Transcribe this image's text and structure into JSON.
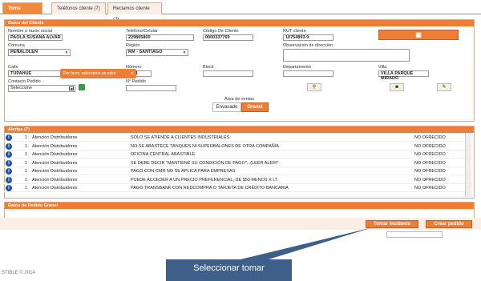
{
  "tabs": [
    "Toma Pedido",
    "Teléfonos cliente (7)",
    "Reclamos cliente (7)"
  ],
  "client": {
    "header": "Datos del Cliente",
    "name_label": "Nombre o razón social",
    "name_value": "PAOLA SUSANA ALVAR",
    "phone_label": "Teléfono/Celular",
    "phone_value": "229805800",
    "code_label": "Código De Cliente",
    "code_value": "0000337769",
    "rut_label": "RUT cliente",
    "rut_value": "10754893-9",
    "comuna_label": "Comuna",
    "comuna_value": "PEÑALOLEN",
    "region_label": "Región",
    "region_value": "RM - SANTIAGO",
    "obs_label": "Observación de dirección",
    "calle_label": "Calle",
    "calle_value": "TUPAHUE",
    "numero_label": "Número",
    "numero_value": "8911",
    "block_label": "Block",
    "depto_label": "Departamento",
    "villa_label": "Villa",
    "villa_value": "VILLA PARQUE MIRADO",
    "contacto_label": "Contacto Pedido",
    "contacto_value": "Seleccione",
    "npedido_label": "N° Pedido",
    "area_label": "Área de ventas",
    "area_opt1": "Envasado",
    "area_opt2": "Granel",
    "tooltip": "Por favor, seleccione un valor",
    "tooltip_close": "✕",
    "contact_arrow": "▼"
  },
  "alerts": {
    "header": "Alertas (7)",
    "rows": [
      {
        "n": "1",
        "who": "Atención Distribuidores",
        "msg": "SÓLO SE ATIENDE A CLIENTES INDUSTRIALES",
        "status": "NO OFRECIDO"
      },
      {
        "n": "1",
        "who": "Atención Distribuidores",
        "msg": "NO SE ABASTECE TANQUES NI SUPERBALONES DE OTRA COMPAÑÍA",
        "status": "NO OFRECIDO"
      },
      {
        "n": "1",
        "who": "Atención Distribuidores",
        "msg": "OFICINA CENTRAL ABASTIBLE",
        "status": "NO OFRECIDO"
      },
      {
        "n": "1",
        "who": "Atención Distribuidores",
        "msg": "SE DEBE DECIR \"MANTIENE SU CONDICIÓN DE PAGO\"...(LEER ALERT",
        "status": "NO OFRECIDO"
      },
      {
        "n": "1",
        "who": "Atención Distribuidores",
        "msg": "PAGO CON CMR NO SE APLICA PARA EMPRESAS",
        "status": "NO OFRECIDO"
      },
      {
        "n": "1",
        "who": "Atención Distribuidores",
        "msg": "PUEDE ACCEDER A UN PRECIO PREFERENCIAL, DE $50 MENOS X LT.",
        "status": "NO OFRECIDO"
      },
      {
        "n": "1",
        "who": "Atención Distribuidores",
        "msg": "PAGO TRANSBANK CON REDCOMPRA O TARJETA DE CRÉDITO BANCARIA",
        "status": "NO OFRECIDO"
      }
    ]
  },
  "granel": {
    "header": "Datos de Pedido Granel"
  },
  "actions": {
    "tomar": "Tomar Incidente",
    "crear": "Crear pedido"
  },
  "footer": {
    "text": "STIBLE © 2014"
  },
  "callout": {
    "text": "Seleccionar tomar"
  },
  "colors": {
    "accent": "#ef7d35",
    "info": "#1e55a8"
  }
}
